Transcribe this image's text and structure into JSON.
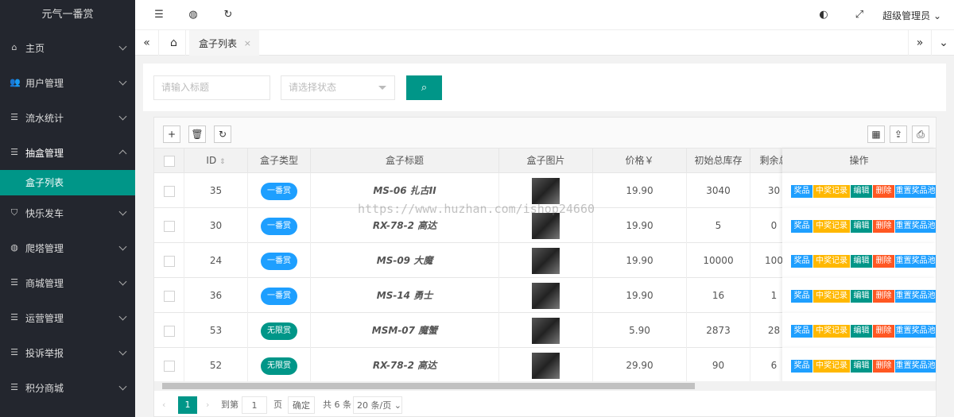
{
  "app": {
    "title": "元气一番赏",
    "user": "超级管理员"
  },
  "sidebar": {
    "items": [
      {
        "label": "主页",
        "icon": "home-icon"
      },
      {
        "label": "用户管理",
        "icon": "users-icon"
      },
      {
        "label": "流水统计",
        "icon": "list-icon"
      },
      {
        "label": "抽盒管理",
        "icon": "list-icon"
      },
      {
        "label": "快乐发车",
        "icon": "shield-icon"
      },
      {
        "label": "爬塔管理",
        "icon": "globe-icon"
      },
      {
        "label": "商城管理",
        "icon": "list-icon"
      },
      {
        "label": "运营管理",
        "icon": "list-icon"
      },
      {
        "label": "投诉举报",
        "icon": "list-icon"
      },
      {
        "label": "积分商城",
        "icon": "list-icon"
      }
    ],
    "sub_active": "盒子列表"
  },
  "tabs": {
    "active": "盒子列表",
    "close": "×"
  },
  "search": {
    "title_placeholder": "请输入标题",
    "status_placeholder": "请选择状态"
  },
  "table": {
    "headers": {
      "id": "ID",
      "type": "盒子类型",
      "title": "盒子标题",
      "image": "盒子图片",
      "price": "价格￥",
      "stock": "初始总库存",
      "remain": "剩余总",
      "ops": "操作"
    },
    "rows": [
      {
        "id": "35",
        "type": "一番赏",
        "title": "MS-06 扎古II",
        "price": "19.90",
        "stock": "3040",
        "remain": "30"
      },
      {
        "id": "30",
        "type": "一番赏",
        "title": "RX-78-2 高达",
        "price": "19.90",
        "stock": "5",
        "remain": "0"
      },
      {
        "id": "24",
        "type": "一番赏",
        "title": "MS-09 大魔",
        "price": "19.90",
        "stock": "10000",
        "remain": "100"
      },
      {
        "id": "36",
        "type": "一番赏",
        "title": "MS-14 勇士",
        "price": "19.90",
        "stock": "16",
        "remain": "1"
      },
      {
        "id": "53",
        "type": "无限赏",
        "title": "MSM-07 魔蟹",
        "price": "5.90",
        "stock": "2873",
        "remain": "28"
      },
      {
        "id": "52",
        "type": "无限赏",
        "title": "RX-78-2 高达",
        "price": "29.90",
        "stock": "90",
        "remain": "6"
      }
    ],
    "ops": [
      "奖品",
      "中奖记录",
      "编辑",
      "删除",
      "重置奖品池"
    ]
  },
  "pager": {
    "page": "1",
    "goto": "到第",
    "page_input": "1",
    "page_unit": "页",
    "confirm": "确定",
    "total": "共 6 条",
    "size": "20 条/页"
  },
  "watermark": "https://www.huzhan.com/ishop24660",
  "colors": {
    "accent": "#009688",
    "blue": "#1e9fff",
    "orange": "#ffb800",
    "red": "#ff5722"
  }
}
